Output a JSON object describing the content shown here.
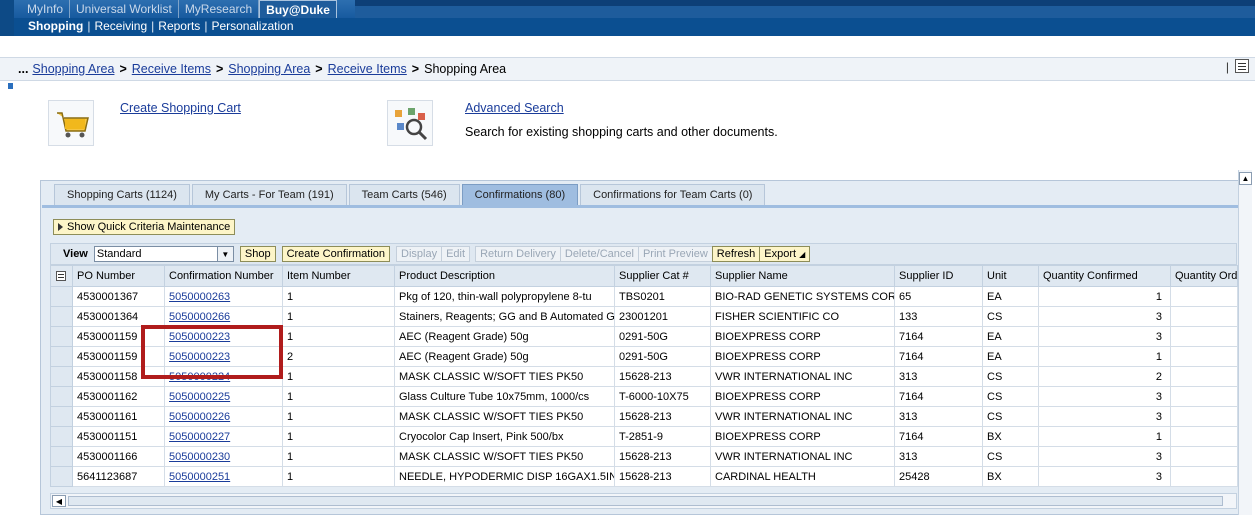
{
  "nav": {
    "top_tabs": [
      "MyInfo",
      "Universal Worklist",
      "MyResearch",
      "Buy@Duke"
    ],
    "active_top_tab": "Buy@Duke",
    "sub_items": [
      "Shopping",
      "Receiving",
      "Reports",
      "Personalization"
    ]
  },
  "breadcrumb": {
    "dots": "...",
    "items": [
      "Shopping Area",
      "Receive Items",
      "Shopping Area",
      "Receive Items"
    ],
    "current": "Shopping Area",
    "separator": ">",
    "right_bar": "|"
  },
  "actions": {
    "create_cart": "Create Shopping Cart",
    "advanced_search": "Advanced Search",
    "advanced_search_desc": "Search for existing shopping carts and other documents."
  },
  "tabs": [
    "Shopping Carts (1124)",
    "My Carts - For Team (191)",
    "Team Carts (546)",
    "Confirmations (80)",
    "Confirmations for Team Carts (0)"
  ],
  "active_tab": "Confirmations (80)",
  "quick_criteria": "Show Quick Criteria Maintenance",
  "toolbar": {
    "view_label": "View",
    "view_value": "Standard",
    "shop": "Shop",
    "create_confirmation": "Create Confirmation",
    "display": "Display",
    "edit": "Edit",
    "return_delivery": "Return Delivery",
    "delete_cancel": "Delete/Cancel",
    "print_preview": "Print Preview",
    "refresh": "Refresh",
    "export": "Export"
  },
  "table": {
    "columns": [
      "PO Number",
      "Confirmation Number",
      "Item Number",
      "Product Description",
      "Supplier Cat #",
      "Supplier Name",
      "Supplier ID",
      "Unit",
      "Quantity Confirmed",
      "Quantity Orde"
    ],
    "rows": [
      [
        "4530001367",
        "5050000263",
        "1",
        "Pkg of 120, thin-wall polypropylene 8-tu",
        "TBS0201",
        "BIO-RAD GENETIC SYSTEMS CORP",
        "65",
        "EA",
        "1",
        ""
      ],
      [
        "4530001364",
        "5050000266",
        "1",
        "Stainers, Reagents; GG and B Automated G",
        "23001201",
        "FISHER SCIENTIFIC CO",
        "133",
        "CS",
        "3",
        ""
      ],
      [
        "4530001159",
        "5050000223",
        "1",
        "AEC (Reagent Grade) 50g",
        "0291-50G",
        "BIOEXPRESS CORP",
        "7164",
        "EA",
        "3",
        ""
      ],
      [
        "4530001159",
        "5050000223",
        "2",
        "AEC (Reagent Grade) 50g",
        "0291-50G",
        "BIOEXPRESS CORP",
        "7164",
        "EA",
        "1",
        ""
      ],
      [
        "4530001158",
        "5050000224",
        "1",
        "MASK CLASSIC W/SOFT TIES PK50",
        "15628-213",
        "VWR INTERNATIONAL INC",
        "313",
        "CS",
        "2",
        ""
      ],
      [
        "4530001162",
        "5050000225",
        "1",
        "Glass Culture Tube 10x75mm, 1000/cs",
        "T-6000-10X75",
        "BIOEXPRESS CORP",
        "7164",
        "CS",
        "3",
        ""
      ],
      [
        "4530001161",
        "5050000226",
        "1",
        "MASK CLASSIC W/SOFT TIES PK50",
        "15628-213",
        "VWR INTERNATIONAL INC",
        "313",
        "CS",
        "3",
        ""
      ],
      [
        "4530001151",
        "5050000227",
        "1",
        "Cryocolor Cap Insert, Pink 500/bx",
        "T-2851-9",
        "BIOEXPRESS CORP",
        "7164",
        "BX",
        "1",
        ""
      ],
      [
        "4530001166",
        "5050000230",
        "1",
        "MASK CLASSIC W/SOFT TIES PK50",
        "15628-213",
        "VWR INTERNATIONAL INC",
        "313",
        "CS",
        "3",
        ""
      ],
      [
        "5641123687",
        "5050000251",
        "1",
        "NEEDLE, HYPODERMIC DISP 16GAX1.5IN",
        "15628-213",
        "CARDINAL HEALTH",
        "25428",
        "BX",
        "3",
        ""
      ]
    ]
  },
  "colors": {
    "nav_blue": "#0b4f91",
    "link": "#1a3c9a",
    "highlight": "#b01c1c",
    "button_yellow": "#fdf5c8"
  }
}
